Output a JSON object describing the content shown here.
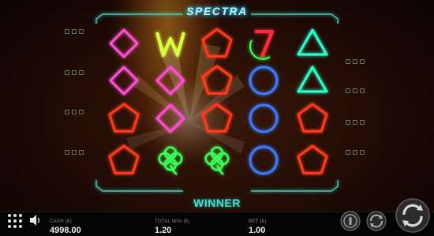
{
  "game": {
    "logo": "SPECTRA",
    "winner_label": "WINNER"
  },
  "reels": [
    [
      "diamond",
      "diamond",
      "pentagon",
      "pentagon"
    ],
    [
      "wild",
      "diamond",
      "diamond",
      "clover"
    ],
    [
      "pentagon",
      "pentagon",
      "pentagon",
      "clover"
    ],
    [
      "seven",
      "circle",
      "circle",
      "circle"
    ],
    [
      "triangle",
      "triangle",
      "pentagon",
      "pentagon"
    ]
  ],
  "symbol_colors": {
    "diamond": "#ff4fd8",
    "pentagon": "#ff3a1e",
    "wild": "#d8ff3a",
    "seven": "#ff2a3a",
    "circle": "#3a7bff",
    "triangle": "#2affd0",
    "clover": "#3aff5a"
  },
  "stats": {
    "cash_label": "CASH (€)",
    "cash_value": "4998.00",
    "total_win_label": "TOTAL WIN (€)",
    "total_win_value": "1.20",
    "bet_label": "BET (€)",
    "bet_value": "1.00"
  },
  "icons": {
    "menu": "grid-dots-icon",
    "sound": "speaker-icon",
    "autoplay": "autoplay-icon",
    "turbo": "turbo-icon",
    "spin": "spin-icon"
  }
}
